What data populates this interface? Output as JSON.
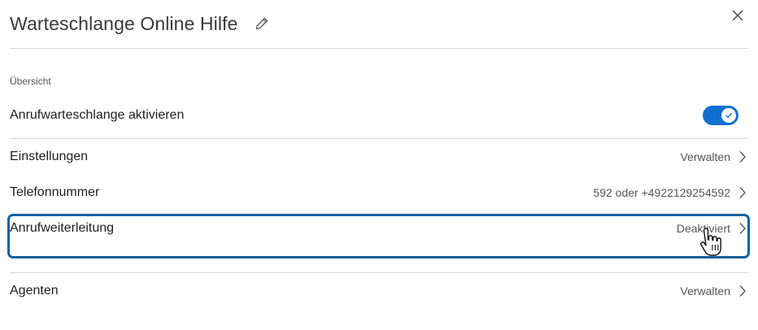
{
  "header": {
    "title": "Warteschlange Online Hilfe",
    "edit_icon": "pencil-icon",
    "close_icon": "close-icon"
  },
  "overview": {
    "section_label": "Übersicht",
    "activate_label": "Anrufwarteschlange aktivieren",
    "toggle_on": true
  },
  "rows": [
    {
      "label": "Einstellungen",
      "value": "Verwalten"
    },
    {
      "label": "Telefonnummer",
      "value": "592 oder +4922129254592"
    },
    {
      "label": "Anrufweiterleitung",
      "value": "Deaktiviert"
    },
    {
      "label": "Agenten",
      "value": "Verwalten"
    }
  ],
  "colors": {
    "accent": "#1170cf",
    "highlight_border": "#16609e",
    "divider": "#d6d6d6"
  }
}
